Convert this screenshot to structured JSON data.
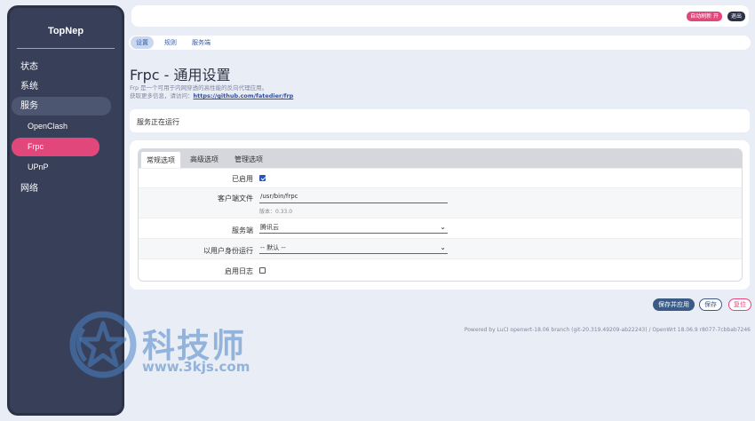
{
  "sidebar": {
    "brand": "TopNep",
    "items": [
      {
        "label": "状态"
      },
      {
        "label": "系统"
      },
      {
        "label": "服务"
      },
      {
        "label": "OpenClash"
      },
      {
        "label": "Frpc"
      },
      {
        "label": "UPnP"
      },
      {
        "label": "网络"
      }
    ]
  },
  "topbar": {
    "auto_refresh": "自动刷新 开",
    "logout": "退出"
  },
  "page_tabs": [
    "设置",
    "规则",
    "服务端"
  ],
  "title": "Frpc - 通用设置",
  "desc_line1": "Frp 是一个可用于内网穿透的高性能的反向代理应用。",
  "desc_line2_prefix": "获取更多信息，请访问：",
  "desc_link": "https://github.com/fatedier/frp",
  "status_text": "服务正在运行",
  "inner_tabs": [
    "常规选项",
    "高级选项",
    "管理选项"
  ],
  "form": {
    "enabled_label": "已启用",
    "client_file_label": "客户端文件",
    "client_file_value": "/usr/bin/frpc",
    "version_hint": "版本：0.33.0",
    "server_label": "服务端",
    "server_value": "腾讯云",
    "run_as_label": "以用户身份运行",
    "run_as_value": "-- 默认 --",
    "log_label": "启用日志"
  },
  "buttons": {
    "apply": "保存并应用",
    "save": "保存",
    "reset": "复位"
  },
  "footer": "Powered by LuCI openwrt-18.06 branch (git-20.319.49209-ab22243) / OpenWrt 18.06.9 r8077-7cbbab7246",
  "watermark": {
    "text": "科技师",
    "url": "www.3kjs.com"
  },
  "colors": {
    "sidebar_bg": "#373f59",
    "accent_pink": "#e2477b",
    "accent_blue": "#3b5b87",
    "page_bg": "#e9edf5"
  }
}
